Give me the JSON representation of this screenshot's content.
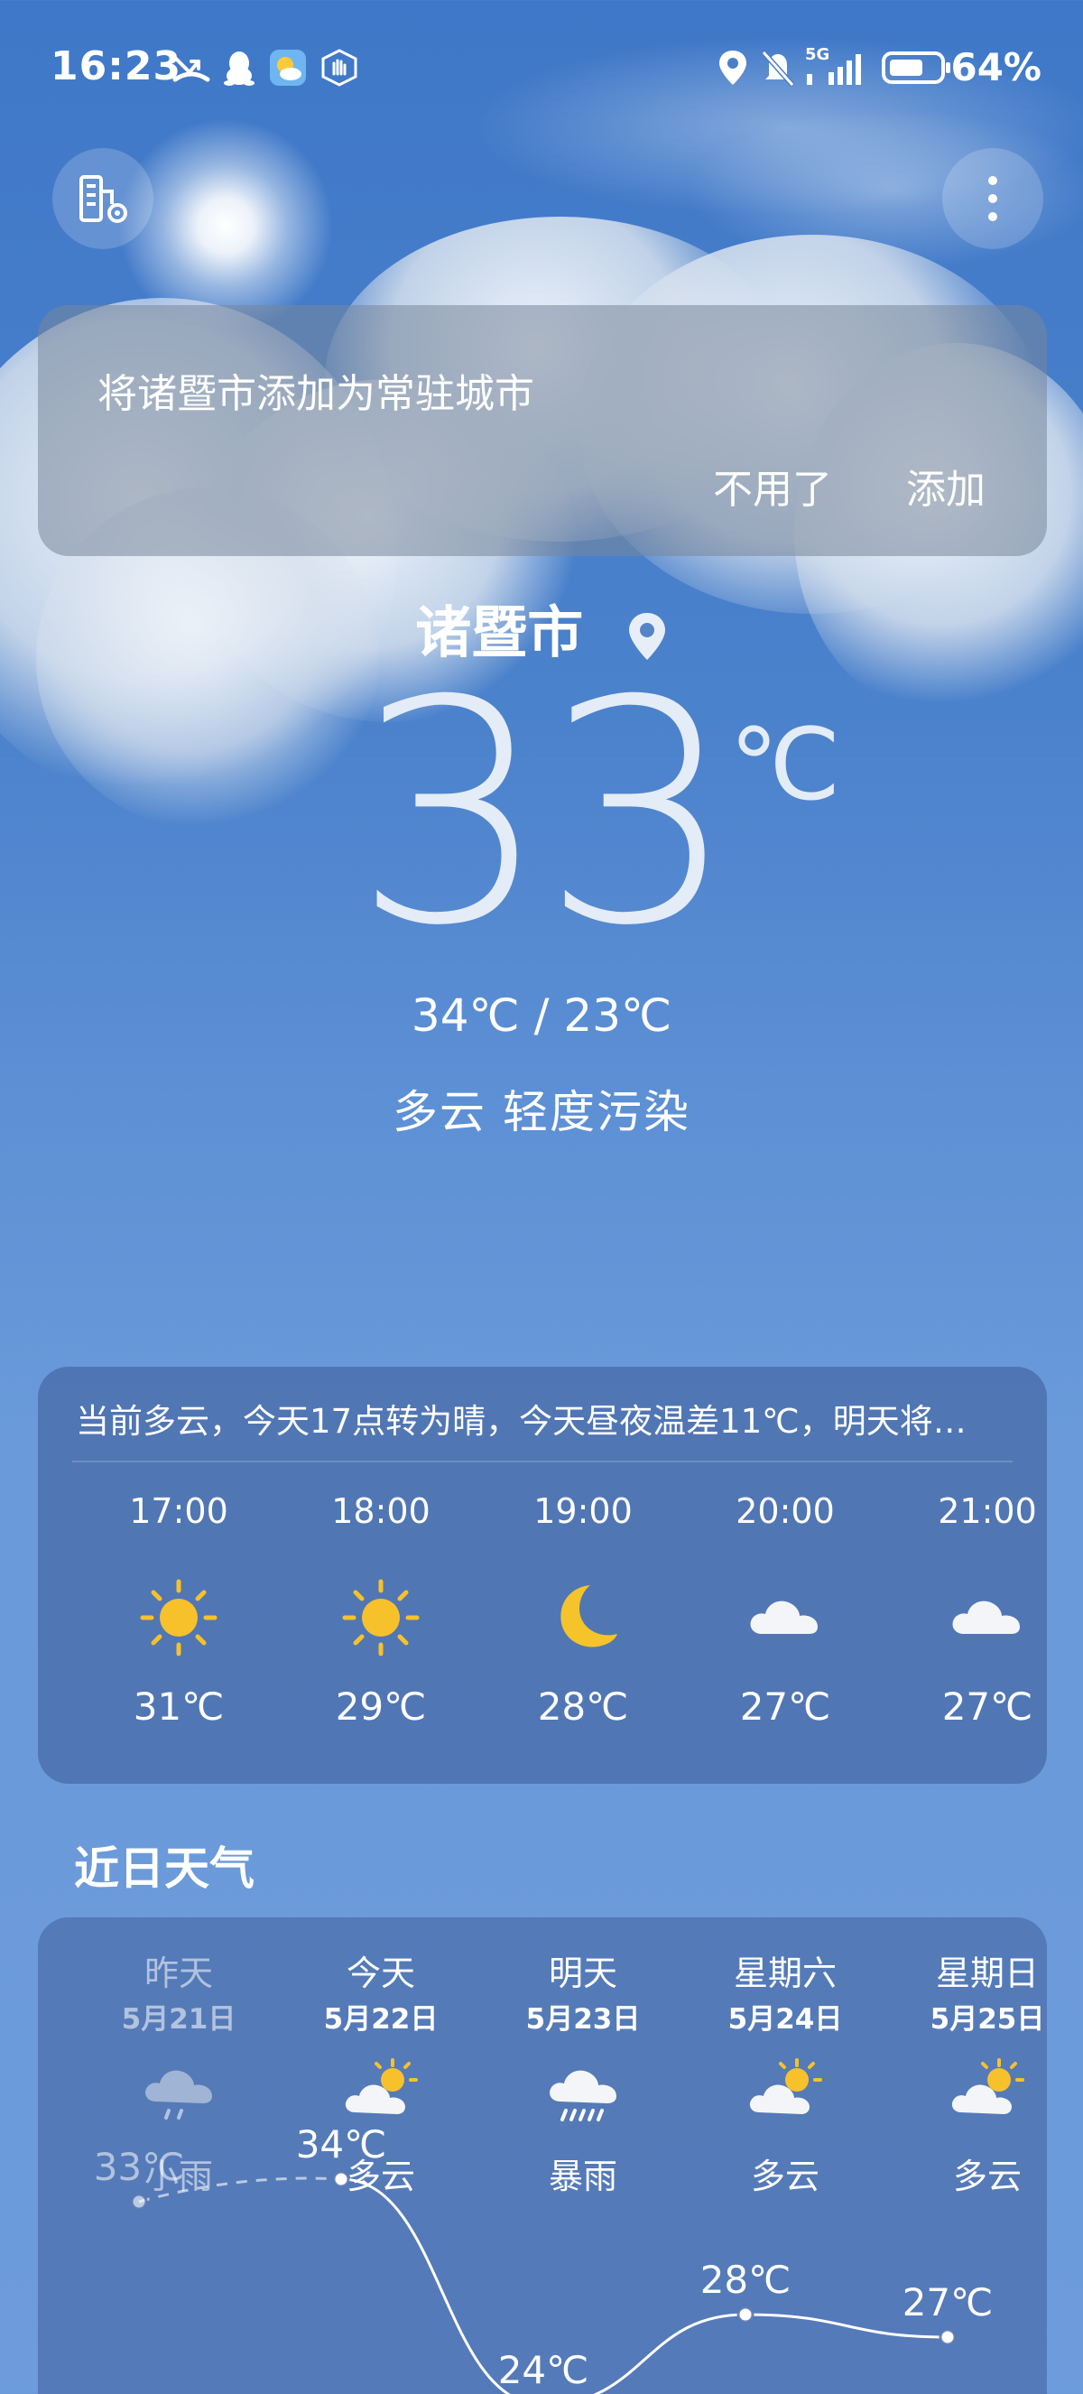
{
  "status_bar": {
    "time": "16:23",
    "battery": "64%",
    "network": "5G",
    "icons": [
      "missed-call-icon",
      "qq-penguin-icon",
      "weather-app-icon",
      "hand-icon",
      "location-icon",
      "mute-bell-icon",
      "signal-icon",
      "battery-icon"
    ]
  },
  "top_bar": {
    "left_icon": "city-manage-icon",
    "right_icon": "more-vertical-icon"
  },
  "prompt": {
    "text": "将诸暨市添加为常驻城市",
    "dismiss": "不用了",
    "add": "添加"
  },
  "current": {
    "city": "诸暨市",
    "temperature": "33",
    "unit": "℃",
    "range": "34℃ / 23℃",
    "condition": "多云  轻度污染"
  },
  "hourly": {
    "summary": "当前多云，今天17点转为晴，今天昼夜温差11℃，明天将…",
    "items": [
      {
        "time": "17:00",
        "icon": "sun-icon",
        "temp": "31℃"
      },
      {
        "time": "18:00",
        "icon": "sun-icon",
        "temp": "29℃"
      },
      {
        "time": "19:00",
        "icon": "moon-icon",
        "temp": "28℃"
      },
      {
        "time": "20:00",
        "icon": "cloud-icon",
        "temp": "27℃"
      },
      {
        "time": "21:00",
        "icon": "cloud-icon",
        "temp": "27℃"
      }
    ]
  },
  "recent": {
    "title": "近日天气",
    "days": [
      {
        "name": "昨天",
        "date": "5月21日",
        "icon": "light-rain-icon",
        "condition": "小雨",
        "high": "33℃",
        "low": "",
        "past": true
      },
      {
        "name": "今天",
        "date": "5月22日",
        "icon": "partly-cloudy-icon",
        "condition": "多云",
        "high": "34℃",
        "low": ""
      },
      {
        "name": "明天",
        "date": "5月23日",
        "icon": "rainstorm-icon",
        "condition": "暴雨",
        "high": "24℃",
        "low": ""
      },
      {
        "name": "星期六",
        "date": "5月24日",
        "icon": "partly-cloudy-icon",
        "condition": "多云",
        "high": "28℃",
        "low": ""
      },
      {
        "name": "星期日",
        "date": "5月25日",
        "icon": "partly-cloudy-icon",
        "condition": "多云",
        "high": "27℃",
        "low": ""
      }
    ],
    "high_values": [
      33,
      34,
      24,
      28,
      27
    ]
  },
  "colors": {
    "sun": "#f7c12b",
    "moon": "#f4c42a",
    "card": "#4a6ea8"
  }
}
